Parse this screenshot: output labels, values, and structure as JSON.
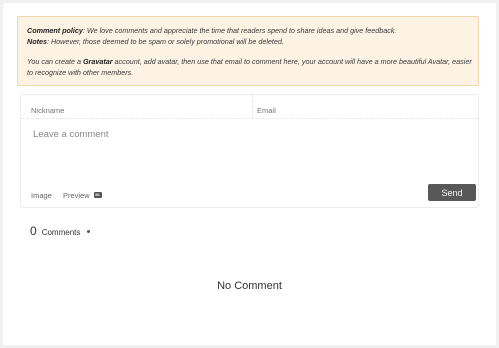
{
  "notice": {
    "policy_title": "Comment policy",
    "policy_text": ": We love comments and appreciate the time that readers spend to share ideas and give feedback.",
    "notes_title": "Notes",
    "notes_text": ": However, those deemed to be spam or solely promotional will be deleted.",
    "gravatar_pre": "You can create a ",
    "gravatar_name": "Gravatar",
    "gravatar_post": " account, add avatar, then use that email to comment here, your account will have a more beautiful Avatar, easier to recognize with other members."
  },
  "form": {
    "nickname_placeholder": "Nickname",
    "email_placeholder": "Email",
    "comment_placeholder": "Leave a comment",
    "image_label": "Image",
    "preview_label": "Preview",
    "markdown_icon": "markdown-icon",
    "send_label": "Send"
  },
  "comments": {
    "count": "0",
    "label": "Comments",
    "empty_text": "No Comment"
  }
}
